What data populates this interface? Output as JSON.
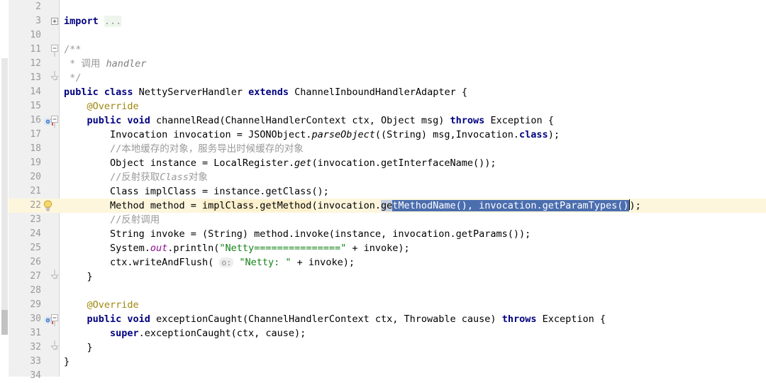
{
  "editor": {
    "language": "java",
    "colors": {
      "keyword": "#000080",
      "comment": "#9a9a9a",
      "string": "#158217",
      "annotation": "#9e880d",
      "static_field": "#8c0f8c",
      "selection_bg": "#4b6eaf",
      "caret_line_bg": "#fdf6dd",
      "gutter_bg": "#f0f0f0",
      "usage_highlight_bg": "#fcf0cd"
    },
    "gutter": {
      "marker_names": [
        "implementing-method-icon",
        "intention-bulb-icon",
        "fold-collapse-icon",
        "fold-expand-icon"
      ]
    },
    "lines": [
      {
        "no": "2",
        "marker": "",
        "fold": "",
        "indent": 0,
        "tokens": []
      },
      {
        "no": "3",
        "marker": "",
        "fold": "expand",
        "indent": 0,
        "tokens": [
          {
            "t": "import ",
            "c": "kw"
          },
          {
            "t": "...",
            "c": "ell"
          }
        ]
      },
      {
        "no": "10",
        "marker": "",
        "fold": "",
        "indent": 0,
        "tokens": []
      },
      {
        "no": "11",
        "marker": "",
        "fold": "collapse-top",
        "indent": 0,
        "tokens": [
          {
            "t": "/**",
            "c": "doc"
          }
        ]
      },
      {
        "no": "12",
        "marker": "",
        "fold": "",
        "indent": 0,
        "tokens": [
          {
            "t": " * ",
            "c": "doc"
          },
          {
            "t": "调用 ",
            "c": "doc"
          },
          {
            "t": "handler",
            "c": "doci"
          }
        ]
      },
      {
        "no": "13",
        "marker": "",
        "fold": "collapse-bottom",
        "indent": 0,
        "tokens": [
          {
            "t": " */",
            "c": "doc"
          }
        ]
      },
      {
        "no": "14",
        "marker": "",
        "fold": "",
        "indent": 0,
        "tokens": [
          {
            "t": "public class ",
            "c": "kw"
          },
          {
            "t": "NettyServerHandler ",
            "c": "iden"
          },
          {
            "t": "extends ",
            "c": "kw"
          },
          {
            "t": "ChannelInboundHandlerAdapter {",
            "c": "iden"
          }
        ]
      },
      {
        "no": "15",
        "marker": "",
        "fold": "",
        "indent": 1,
        "tokens": [
          {
            "t": "@Override",
            "c": "anno"
          }
        ]
      },
      {
        "no": "16",
        "marker": "implementing-method",
        "fold": "collapse-top",
        "indent": 1,
        "tokens": [
          {
            "t": "public void ",
            "c": "kw"
          },
          {
            "t": "channelRead(ChannelHandlerContext ctx, Object msg) ",
            "c": "iden"
          },
          {
            "t": "throws ",
            "c": "kw"
          },
          {
            "t": "Exception {",
            "c": "iden"
          }
        ]
      },
      {
        "no": "17",
        "marker": "",
        "fold": "",
        "indent": 2,
        "tokens": [
          {
            "t": "Invocation invocation = JSONObject.",
            "c": "iden"
          },
          {
            "t": "parseObject",
            "c": "mi"
          },
          {
            "t": "((String) msg,Invocation.",
            "c": "iden"
          },
          {
            "t": "class",
            "c": "kw"
          },
          {
            "t": ");",
            "c": "iden"
          }
        ]
      },
      {
        "no": "18",
        "marker": "",
        "fold": "",
        "indent": 2,
        "tokens": [
          {
            "t": "//本地缓存的对象，服务导出时候缓存的对象",
            "c": "com"
          }
        ]
      },
      {
        "no": "19",
        "marker": "",
        "fold": "",
        "indent": 2,
        "tokens": [
          {
            "t": "Object instance = LocalRegister.",
            "c": "iden"
          },
          {
            "t": "get",
            "c": "mi"
          },
          {
            "t": "(invocation.getInterfaceName());",
            "c": "iden"
          }
        ]
      },
      {
        "no": "20",
        "marker": "",
        "fold": "",
        "indent": 2,
        "tokens": [
          {
            "t": "//反射获取",
            "c": "com"
          },
          {
            "t": "Class",
            "c": "comi"
          },
          {
            "t": "对象",
            "c": "com"
          }
        ]
      },
      {
        "no": "21",
        "marker": "",
        "fold": "",
        "indent": 2,
        "tokens": [
          {
            "t": "Class implClass = instance.getClass();",
            "c": "iden"
          }
        ]
      },
      {
        "no": "22",
        "marker": "intention-bulb",
        "fold": "",
        "indent": 2,
        "highlight": true,
        "tokens": [
          {
            "t": "Method method = ",
            "c": "iden"
          },
          {
            "t": "implClass.getMethod",
            "c": "usehl"
          },
          {
            "t": "(invocation.",
            "c": "iden"
          },
          {
            "t": "ge",
            "c": "sel-pre"
          },
          {
            "t": "tMethodName(), invocation.getParamTypes()",
            "c": "sel"
          },
          {
            "t": ");",
            "c": "iden"
          }
        ]
      },
      {
        "no": "23",
        "marker": "",
        "fold": "",
        "indent": 2,
        "tokens": [
          {
            "t": "//反射调用",
            "c": "com"
          }
        ]
      },
      {
        "no": "24",
        "marker": "",
        "fold": "",
        "indent": 2,
        "tokens": [
          {
            "t": "String invoke = (String) method.invoke(instance, invocation.getParams());",
            "c": "iden"
          }
        ]
      },
      {
        "no": "25",
        "marker": "",
        "fold": "",
        "indent": 2,
        "tokens": [
          {
            "t": "System.",
            "c": "iden"
          },
          {
            "t": "out",
            "c": "stat"
          },
          {
            "t": ".println(",
            "c": "iden"
          },
          {
            "t": "\"Netty===============\"",
            "c": "str"
          },
          {
            "t": " + invoke);",
            "c": "iden"
          }
        ]
      },
      {
        "no": "26",
        "marker": "",
        "fold": "",
        "indent": 2,
        "tokens": [
          {
            "t": "ctx.writeAndFlush( ",
            "c": "iden"
          },
          {
            "t": "o:",
            "c": "hint"
          },
          {
            "t": " ",
            "c": "iden"
          },
          {
            "t": "\"Netty: \"",
            "c": "str"
          },
          {
            "t": " + invoke);",
            "c": "iden"
          }
        ]
      },
      {
        "no": "27",
        "marker": "",
        "fold": "collapse-bottom",
        "indent": 1,
        "tokens": [
          {
            "t": "}",
            "c": "iden"
          }
        ]
      },
      {
        "no": "28",
        "marker": "",
        "fold": "",
        "indent": 0,
        "tokens": []
      },
      {
        "no": "29",
        "marker": "",
        "fold": "",
        "indent": 1,
        "tokens": [
          {
            "t": "@Override",
            "c": "anno"
          }
        ]
      },
      {
        "no": "30",
        "marker": "implementing-method",
        "fold": "collapse-top",
        "indent": 1,
        "tokens": [
          {
            "t": "public void ",
            "c": "kw"
          },
          {
            "t": "exceptionCaught(ChannelHandlerContext ctx, Throwable cause) ",
            "c": "iden"
          },
          {
            "t": "throws ",
            "c": "kw"
          },
          {
            "t": "Exception {",
            "c": "iden"
          }
        ]
      },
      {
        "no": "31",
        "marker": "",
        "fold": "",
        "indent": 2,
        "tokens": [
          {
            "t": "super",
            "c": "kw"
          },
          {
            "t": ".exceptionCaught(ctx, cause);",
            "c": "iden"
          }
        ]
      },
      {
        "no": "32",
        "marker": "",
        "fold": "collapse-bottom",
        "indent": 1,
        "tokens": [
          {
            "t": "}",
            "c": "iden"
          }
        ]
      },
      {
        "no": "33",
        "marker": "",
        "fold": "",
        "indent": 0,
        "tokens": [
          {
            "t": "}",
            "c": "iden"
          }
        ]
      },
      {
        "no": "34",
        "marker": "",
        "fold": "",
        "indent": 0,
        "tokens": []
      }
    ]
  }
}
